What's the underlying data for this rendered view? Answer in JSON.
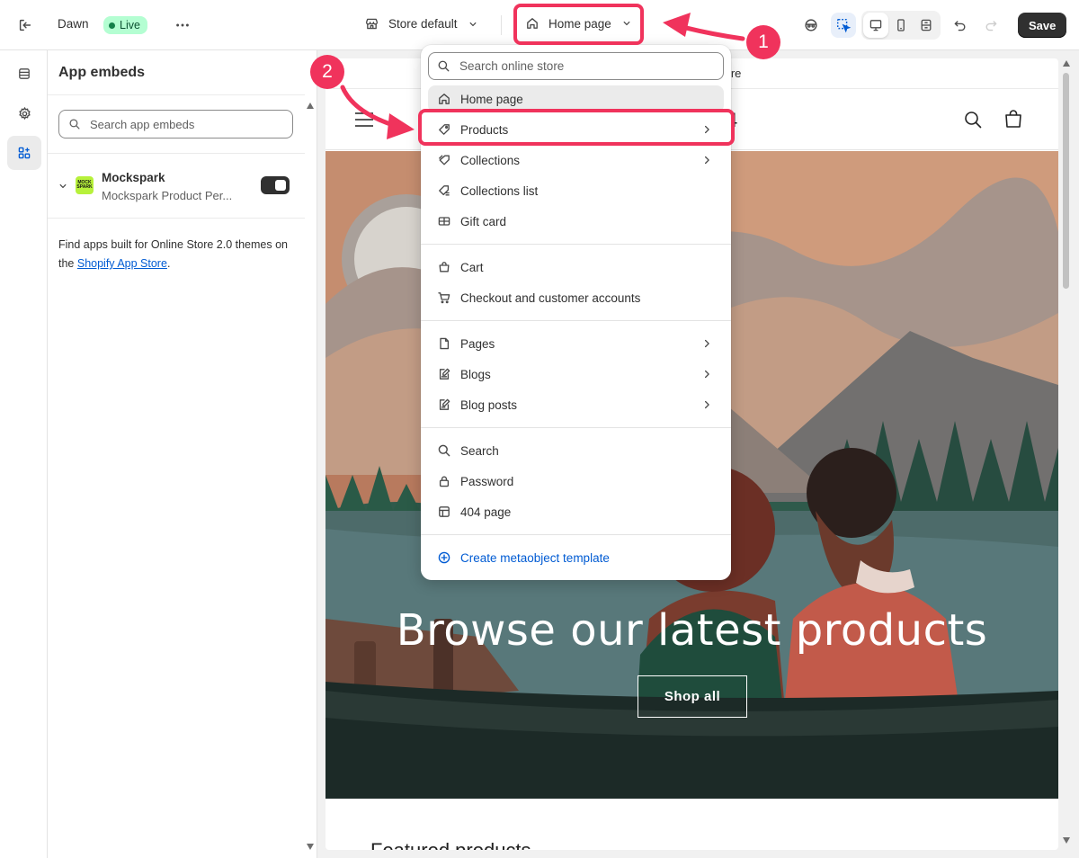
{
  "topbar": {
    "theme_name": "Dawn",
    "live_label": "Live",
    "store_selector": "Store default",
    "page_selector": "Home page",
    "save_label": "Save"
  },
  "panel": {
    "title": "App embeds",
    "search_placeholder": "Search app embeds",
    "app": {
      "name": "Mockspark",
      "subtitle": "Mockspark Product Per...",
      "logo_text": "MOCK SPARK",
      "enabled": true
    },
    "help_text": "Find apps built for Online Store 2.0 themes on the ",
    "help_link": "Shopify App Store",
    "help_suffix": "."
  },
  "preview": {
    "url_suffix": "tore",
    "logo_tail": "4",
    "hero_title": "Browse our latest products",
    "hero_button": "Shop all",
    "featured_title": "Featured products"
  },
  "dropdown": {
    "search_placeholder": "Search online store",
    "groups": [
      [
        {
          "label": "Home page",
          "icon": "home-icon",
          "selected": true,
          "chevron": false
        },
        {
          "label": "Products",
          "icon": "tag-icon",
          "selected": false,
          "chevron": true
        },
        {
          "label": "Collections",
          "icon": "collection-icon",
          "selected": false,
          "chevron": true
        },
        {
          "label": "Collections list",
          "icon": "collection-list-icon",
          "selected": false,
          "chevron": false
        },
        {
          "label": "Gift card",
          "icon": "gift-card-icon",
          "selected": false,
          "chevron": false
        }
      ],
      [
        {
          "label": "Cart",
          "icon": "cart-icon",
          "selected": false,
          "chevron": false
        },
        {
          "label": "Checkout and customer accounts",
          "icon": "checkout-cart-icon",
          "selected": false,
          "chevron": false
        }
      ],
      [
        {
          "label": "Pages",
          "icon": "page-icon",
          "selected": false,
          "chevron": true
        },
        {
          "label": "Blogs",
          "icon": "blog-icon",
          "selected": false,
          "chevron": true
        },
        {
          "label": "Blog posts",
          "icon": "blog-post-icon",
          "selected": false,
          "chevron": true
        }
      ],
      [
        {
          "label": "Search",
          "icon": "search-icon",
          "selected": false,
          "chevron": false
        },
        {
          "label": "Password",
          "icon": "lock-icon",
          "selected": false,
          "chevron": false
        },
        {
          "label": "404 page",
          "icon": "layout-icon",
          "selected": false,
          "chevron": false
        }
      ]
    ],
    "create_label": "Create metaobject template"
  },
  "annotations": {
    "step1": "1",
    "step2": "2",
    "color": "#f0335c"
  },
  "colors": {
    "accent": "#005bd3",
    "live_bg": "#b4fed2",
    "save_bg": "#303030"
  }
}
